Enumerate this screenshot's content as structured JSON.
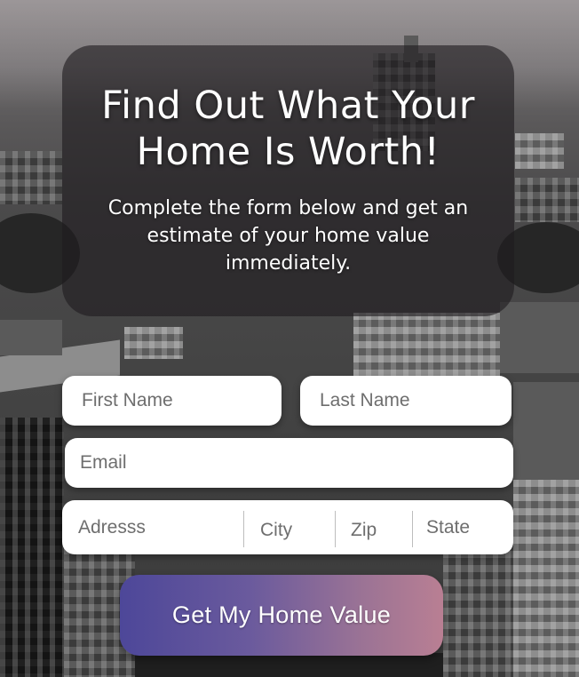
{
  "hero": {
    "title": "Find Out What Your Home Is Worth!",
    "subtitle": "Complete the form below and get an estimate of your home value immediately."
  },
  "form": {
    "first_name": {
      "placeholder": "First Name",
      "value": ""
    },
    "last_name": {
      "placeholder": "Last Name",
      "value": ""
    },
    "email": {
      "placeholder": "Email",
      "value": ""
    },
    "address": {
      "placeholder": "Adresss",
      "value": ""
    },
    "city": {
      "placeholder": "City",
      "value": ""
    },
    "zip": {
      "placeholder": "Zip",
      "value": ""
    },
    "state": {
      "placeholder": "State",
      "value": ""
    },
    "submit_label": "Get My Home Value"
  },
  "colors": {
    "card_overlay": "#1e1c1e",
    "field_background": "#ffffff",
    "button_gradient_start": "#4d4799",
    "button_gradient_end": "#b97f93",
    "text_light": "#ffffff"
  }
}
